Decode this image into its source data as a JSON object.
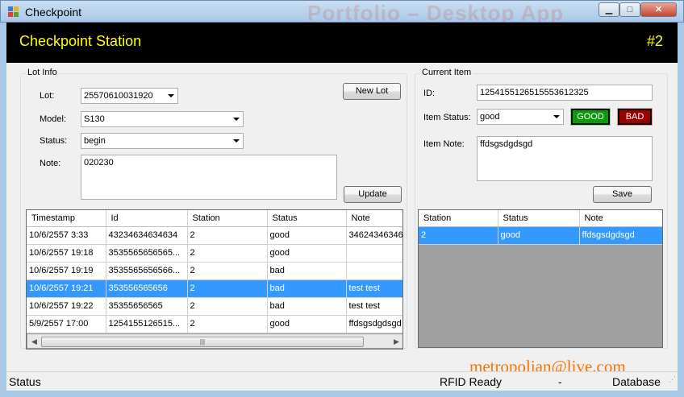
{
  "window": {
    "title": "Checkpoint",
    "background_ghost_text": "Portfolio – Desktop App"
  },
  "header": {
    "title": "Checkpoint Station",
    "station_number": "#2"
  },
  "lot_info": {
    "group_label": "Lot Info",
    "lot_label": "Lot:",
    "lot_value": "25570610031920",
    "model_label": "Model:",
    "model_value": "S130",
    "status_label": "Status:",
    "status_value": "begin",
    "note_label": "Note:",
    "note_value": "020230",
    "new_lot_button": "New Lot",
    "update_button": "Update"
  },
  "lot_table": {
    "columns": [
      "Timestamp",
      "Id",
      "Station",
      "Status",
      "Note"
    ],
    "selected_row": 3,
    "rows": [
      [
        "10/6/2557 3:33",
        "43234634634634",
        "2",
        "good",
        "34624346346"
      ],
      [
        "10/6/2557 19:18",
        "3535565656565...",
        "2",
        "good",
        ""
      ],
      [
        "10/6/2557 19:19",
        "3535565656566...",
        "2",
        "bad",
        ""
      ],
      [
        "10/6/2557 19:21",
        "353556565656",
        "2",
        "bad",
        "test test"
      ],
      [
        "10/6/2557 19:22",
        "35355656565",
        "2",
        "bad",
        "test test"
      ],
      [
        "5/9/2557 17:00",
        "1254155126515...",
        "2",
        "good",
        "ffdsgsdgdsgd"
      ]
    ]
  },
  "current_item": {
    "group_label": "Current Item",
    "id_label": "ID:",
    "id_value": "1254155126515553612325",
    "status_label": "Item Status:",
    "status_value": "good",
    "good_button": "GOOD",
    "bad_button": "BAD",
    "note_label": "Item Note:",
    "note_value": "ffdsgsdgdsgd",
    "save_button": "Save"
  },
  "item_table": {
    "columns": [
      "Station",
      "Status",
      "Note"
    ],
    "selected_row": 0,
    "rows": [
      [
        "2",
        "good",
        "ffdsgsdgdsgd"
      ]
    ]
  },
  "statusbar": {
    "status": "Status",
    "rfid": "RFID Ready",
    "separator": "-",
    "database": "Database"
  },
  "watermark": "metropolian@live.com",
  "colors": {
    "header_bg": "#000000",
    "header_text": "#ffff00",
    "selection": "#3399ff",
    "good": "#0a9b0a",
    "bad": "#9b0000",
    "watermark": "#ff7300"
  }
}
